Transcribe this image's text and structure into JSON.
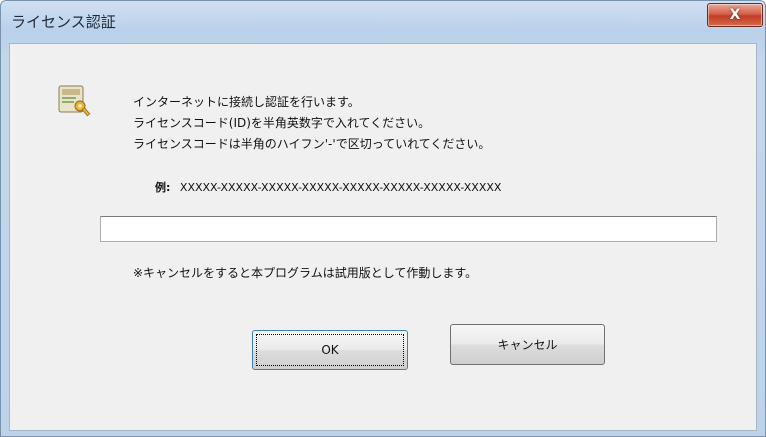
{
  "window": {
    "title": "ライセンス認証",
    "close_label": "X"
  },
  "dialog": {
    "icon": "certificate-key-icon",
    "message_lines": [
      "インターネットに接続し認証を行います。",
      "ライセンスコード(ID)を半角英数字で入れてください。",
      "ライセンスコードは半角のハイフン'-'で区切っていれてください。"
    ],
    "example_label": "例:",
    "example_value": "XXXXX-XXXXX-XXXXX-XXXXX-XXXXX-XXXXX-XXXXX-XXXXX",
    "input_value": "",
    "note": "※キャンセルをすると本プログラムは試用版として作動します。"
  },
  "buttons": {
    "ok": "OK",
    "cancel": "キャンセル"
  },
  "colors": {
    "close_button": "#c23d24",
    "frame": "#b9d1ea",
    "client": "#f0f0f0"
  }
}
